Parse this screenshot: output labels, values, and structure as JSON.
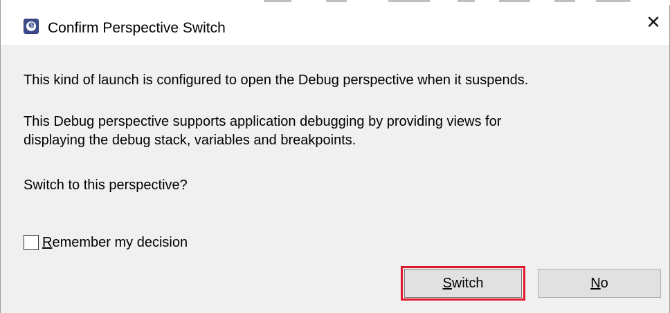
{
  "window": {
    "title": "Confirm Perspective Switch",
    "icon": "eclipse-app-icon",
    "close_glyph": "✕"
  },
  "message": {
    "line1": "This kind of launch is configured to open the Debug perspective when it suspends.",
    "line2a": "This Debug perspective supports application debugging by providing views for",
    "line2b": "displaying the debug stack, variables and breakpoints.",
    "line3": "Switch to this perspective?"
  },
  "remember": {
    "checked": false,
    "label_first": "R",
    "label_rest": "emember my decision"
  },
  "buttons": {
    "switch_first": "S",
    "switch_rest": "witch",
    "no_first": "N",
    "no_rest": "o"
  },
  "colors": {
    "dialog_background": "#f0f0f0",
    "titlebar_background": "#ffffff",
    "button_face": "#e1e1e1",
    "highlight_border": "#e0182d"
  }
}
